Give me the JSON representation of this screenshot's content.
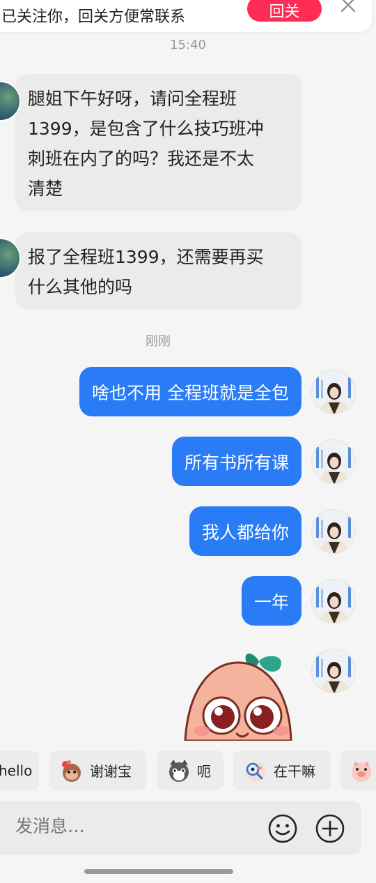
{
  "banner": {
    "text": "已关注你，回关方便常联系",
    "follow_label": "回关"
  },
  "timestamps": {
    "first": "15:40",
    "second": "刚刚"
  },
  "messages_in": [
    {
      "lines": [
        "腿姐下午好呀，请问全程班",
        "1399，是包含了什么技巧班冲",
        "刺班在内了的吗？我还是不太",
        "清楚"
      ]
    },
    {
      "lines": [
        "报了全程班1399，还需要再买",
        "什么其他的吗"
      ]
    }
  ],
  "messages_out": [
    {
      "text": "啥也不用 全程班就是全包"
    },
    {
      "text": "所有书所有课"
    },
    {
      "text": "我人都给你"
    },
    {
      "text": "一年"
    }
  ],
  "quick_replies": [
    {
      "label": "hello"
    },
    {
      "label": "谢谢宝",
      "icon": "monkey-emoji-icon"
    },
    {
      "label": "呃",
      "icon": "cat-emoji-icon"
    },
    {
      "label": "在干嘛",
      "icon": "magnifier-emoji-icon"
    },
    {
      "label": "",
      "icon": "pig-emoji-icon"
    }
  ],
  "composer": {
    "placeholder": "发消息…"
  },
  "colors": {
    "accent": "#2a7bf6",
    "follow": "#fe2c55"
  }
}
